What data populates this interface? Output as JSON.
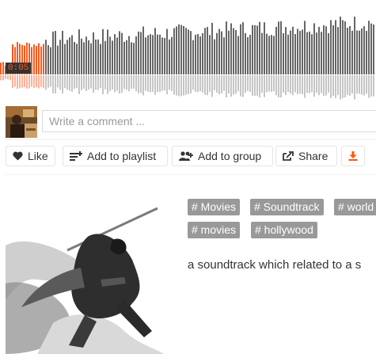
{
  "player": {
    "timecode": "0:05",
    "progress_fraction": 0.115,
    "played_color": "#f75a20",
    "unplayed_color": "#666666",
    "reflection_color": "#c6c6c6"
  },
  "comment": {
    "placeholder": "Write a comment ..."
  },
  "actions": {
    "like_label": "Like",
    "playlist_label": "Add to playlist",
    "group_label": "Add to group",
    "share_label": "Share",
    "download_icon": "download-icon",
    "download_color": "#f50"
  },
  "tags": [
    {
      "label": "# Movies"
    },
    {
      "label": "# Soundtrack"
    },
    {
      "label": "# world"
    },
    {
      "label": "# movies"
    },
    {
      "label": "# hollywood"
    }
  ],
  "description": "a soundtrack which related to a s"
}
